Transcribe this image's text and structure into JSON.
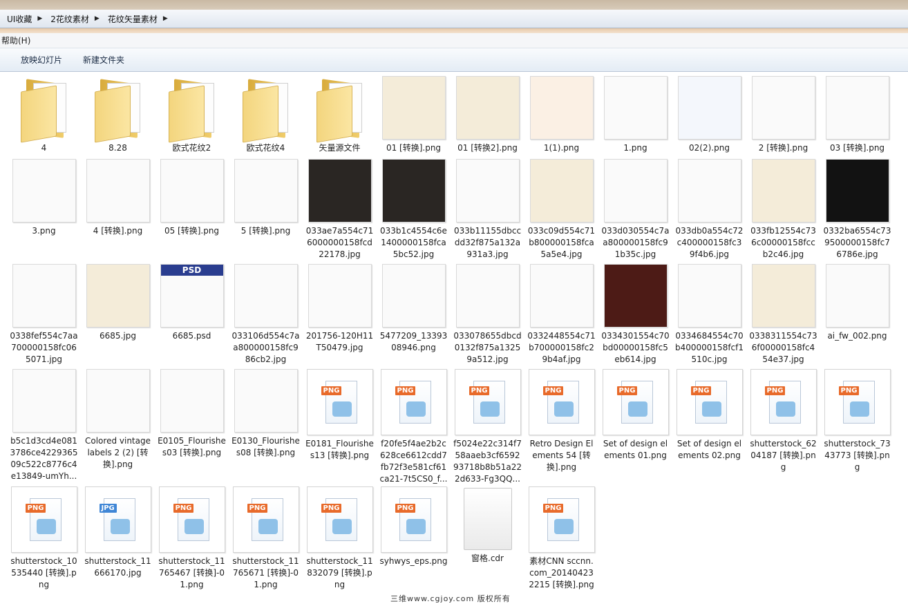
{
  "breadcrumb": [
    "UI收藏",
    "2花纹素材",
    "花纹矢量素材"
  ],
  "menu": {
    "help": "帮助(H)"
  },
  "toolbar": {
    "slideshow": "放映幻灯片",
    "new_folder": "新建文件夹"
  },
  "watermark": "三维www.cgjoy.com 版权所有",
  "colors": {
    "folder": "#f0cd6c",
    "png_badge": "#e86a2a",
    "jpg_badge": "#3f86d6",
    "toolbar": "#e4ecf5"
  },
  "files": [
    {
      "name": "4",
      "kind": "folder"
    },
    {
      "name": "8.28",
      "kind": "folder"
    },
    {
      "name": "欧式花纹2",
      "kind": "folder"
    },
    {
      "name": "欧式花纹4",
      "kind": "folder"
    },
    {
      "name": "矢量源文件",
      "kind": "folder"
    },
    {
      "name": "01 [转换].png",
      "kind": "thumb",
      "tone": "cream"
    },
    {
      "name": "01 [转换2].png",
      "kind": "thumb",
      "tone": "cream"
    },
    {
      "name": "1(1).png",
      "kind": "thumb",
      "tone": "orange"
    },
    {
      "name": "1.png",
      "kind": "thumb",
      "tone": "white"
    },
    {
      "name": "02(2).png",
      "kind": "thumb",
      "tone": "blue"
    },
    {
      "name": "2 [转换].png",
      "kind": "thumb",
      "tone": "white"
    },
    {
      "name": "03 [转换].png",
      "kind": "thumb",
      "tone": "white"
    },
    {
      "name": "3.png",
      "kind": "thumb",
      "tone": "white"
    },
    {
      "name": "4 [转换].png",
      "kind": "thumb",
      "tone": "white"
    },
    {
      "name": "05 [转换].png",
      "kind": "thumb",
      "tone": "white"
    },
    {
      "name": "5 [转换].png",
      "kind": "thumb",
      "tone": "white"
    },
    {
      "name": "033ae7a554c716000000158fcd22178.jpg",
      "kind": "thumb",
      "tone": "dark"
    },
    {
      "name": "033b1c4554c6e1400000158fca5bc52.jpg",
      "kind": "thumb",
      "tone": "dark"
    },
    {
      "name": "033b11155dbccdd32f875a132a931a3.jpg",
      "kind": "thumb",
      "tone": "white"
    },
    {
      "name": "033c09d554c71b800000158fca5a5e4.jpg",
      "kind": "thumb",
      "tone": "cream"
    },
    {
      "name": "033d030554c7aa800000158fc91b35c.jpg",
      "kind": "thumb",
      "tone": "white"
    },
    {
      "name": "033db0a554c72c400000158fc39f4b6.jpg",
      "kind": "thumb",
      "tone": "white"
    },
    {
      "name": "033fb12554c736c00000158fccb2c46.jpg",
      "kind": "thumb",
      "tone": "cream"
    },
    {
      "name": "0332ba6554c739500000158fc76786e.jpg",
      "kind": "thumb",
      "tone": "black"
    },
    {
      "name": "0338fef554c7aa700000158fc065071.jpg",
      "kind": "thumb",
      "tone": "white"
    },
    {
      "name": "6685.jpg",
      "kind": "thumb",
      "tone": "cream"
    },
    {
      "name": "6685.psd",
      "kind": "thumb",
      "tone": "white",
      "tag": "PSD"
    },
    {
      "name": "033106d554c7aa800000158fc986cb2.jpg",
      "kind": "thumb",
      "tone": "white"
    },
    {
      "name": "201756-120H11T50479.jpg",
      "kind": "thumb",
      "tone": "white"
    },
    {
      "name": "5477209_1339308946.png",
      "kind": "thumb",
      "tone": "white"
    },
    {
      "name": "033078655dbcd0132f875a13259a512.jpg",
      "kind": "thumb",
      "tone": "white"
    },
    {
      "name": "0332448554c71b700000158fc29b4af.jpg",
      "kind": "thumb",
      "tone": "white"
    },
    {
      "name": "0334301554c70bd00000158fc5eb614.jpg",
      "kind": "thumb",
      "tone": "maroon"
    },
    {
      "name": "0334684554c70b400000158fcf1510c.jpg",
      "kind": "thumb",
      "tone": "white"
    },
    {
      "name": "0338311554c736f00000158fc454e37.jpg",
      "kind": "thumb",
      "tone": "cream"
    },
    {
      "name": "ai_fw_002.png",
      "kind": "thumb",
      "tone": "white"
    },
    {
      "name": "b5c1d3cd4e0813786ce422936509c522c8776c4e13849-umYh...",
      "kind": "thumb",
      "tone": "white"
    },
    {
      "name": "Colored vintage labels 2 (2) [转换].png",
      "kind": "thumb",
      "tone": "white"
    },
    {
      "name": "E0105_Flourishes03 [转换].png",
      "kind": "thumb",
      "tone": "white"
    },
    {
      "name": "E0130_Flourishes08 [转换].png",
      "kind": "thumb",
      "tone": "white"
    },
    {
      "name": "E0181_Flourishes13 [转换].png",
      "kind": "png"
    },
    {
      "name": "f20fe5f4ae2b2c628ce6612cdd7fb72f3e581cf61ca21-7t5CS0_f...",
      "kind": "png"
    },
    {
      "name": "f5024e22c314f758aaeb3cf659293718b8b51a222d633-Fg3QQ...",
      "kind": "png"
    },
    {
      "name": "Retro Design Elements 54 [转换].png",
      "kind": "png"
    },
    {
      "name": "Set of design elements 01.png",
      "kind": "png"
    },
    {
      "name": "Set of design elements 02.png",
      "kind": "png"
    },
    {
      "name": "shutterstock_6204187 [转换].png",
      "kind": "png"
    },
    {
      "name": "shutterstock_7343773 [转换].png",
      "kind": "png"
    },
    {
      "name": "shutterstock_10535440 [转换].png",
      "kind": "png"
    },
    {
      "name": "shutterstock_11666170.jpg",
      "kind": "jpg"
    },
    {
      "name": "shutterstock_11765467 [转换]-01.png",
      "kind": "png"
    },
    {
      "name": "shutterstock_11765671 [转换]-01.png",
      "kind": "png"
    },
    {
      "name": "shutterstock_11832079 [转换].png",
      "kind": "png"
    },
    {
      "name": "syhwys_eps.png",
      "kind": "png"
    },
    {
      "name": "窗格.cdr",
      "kind": "blank"
    },
    {
      "name": "素材CNN sccnn.com_201404232215 [转换].png",
      "kind": "png"
    }
  ]
}
